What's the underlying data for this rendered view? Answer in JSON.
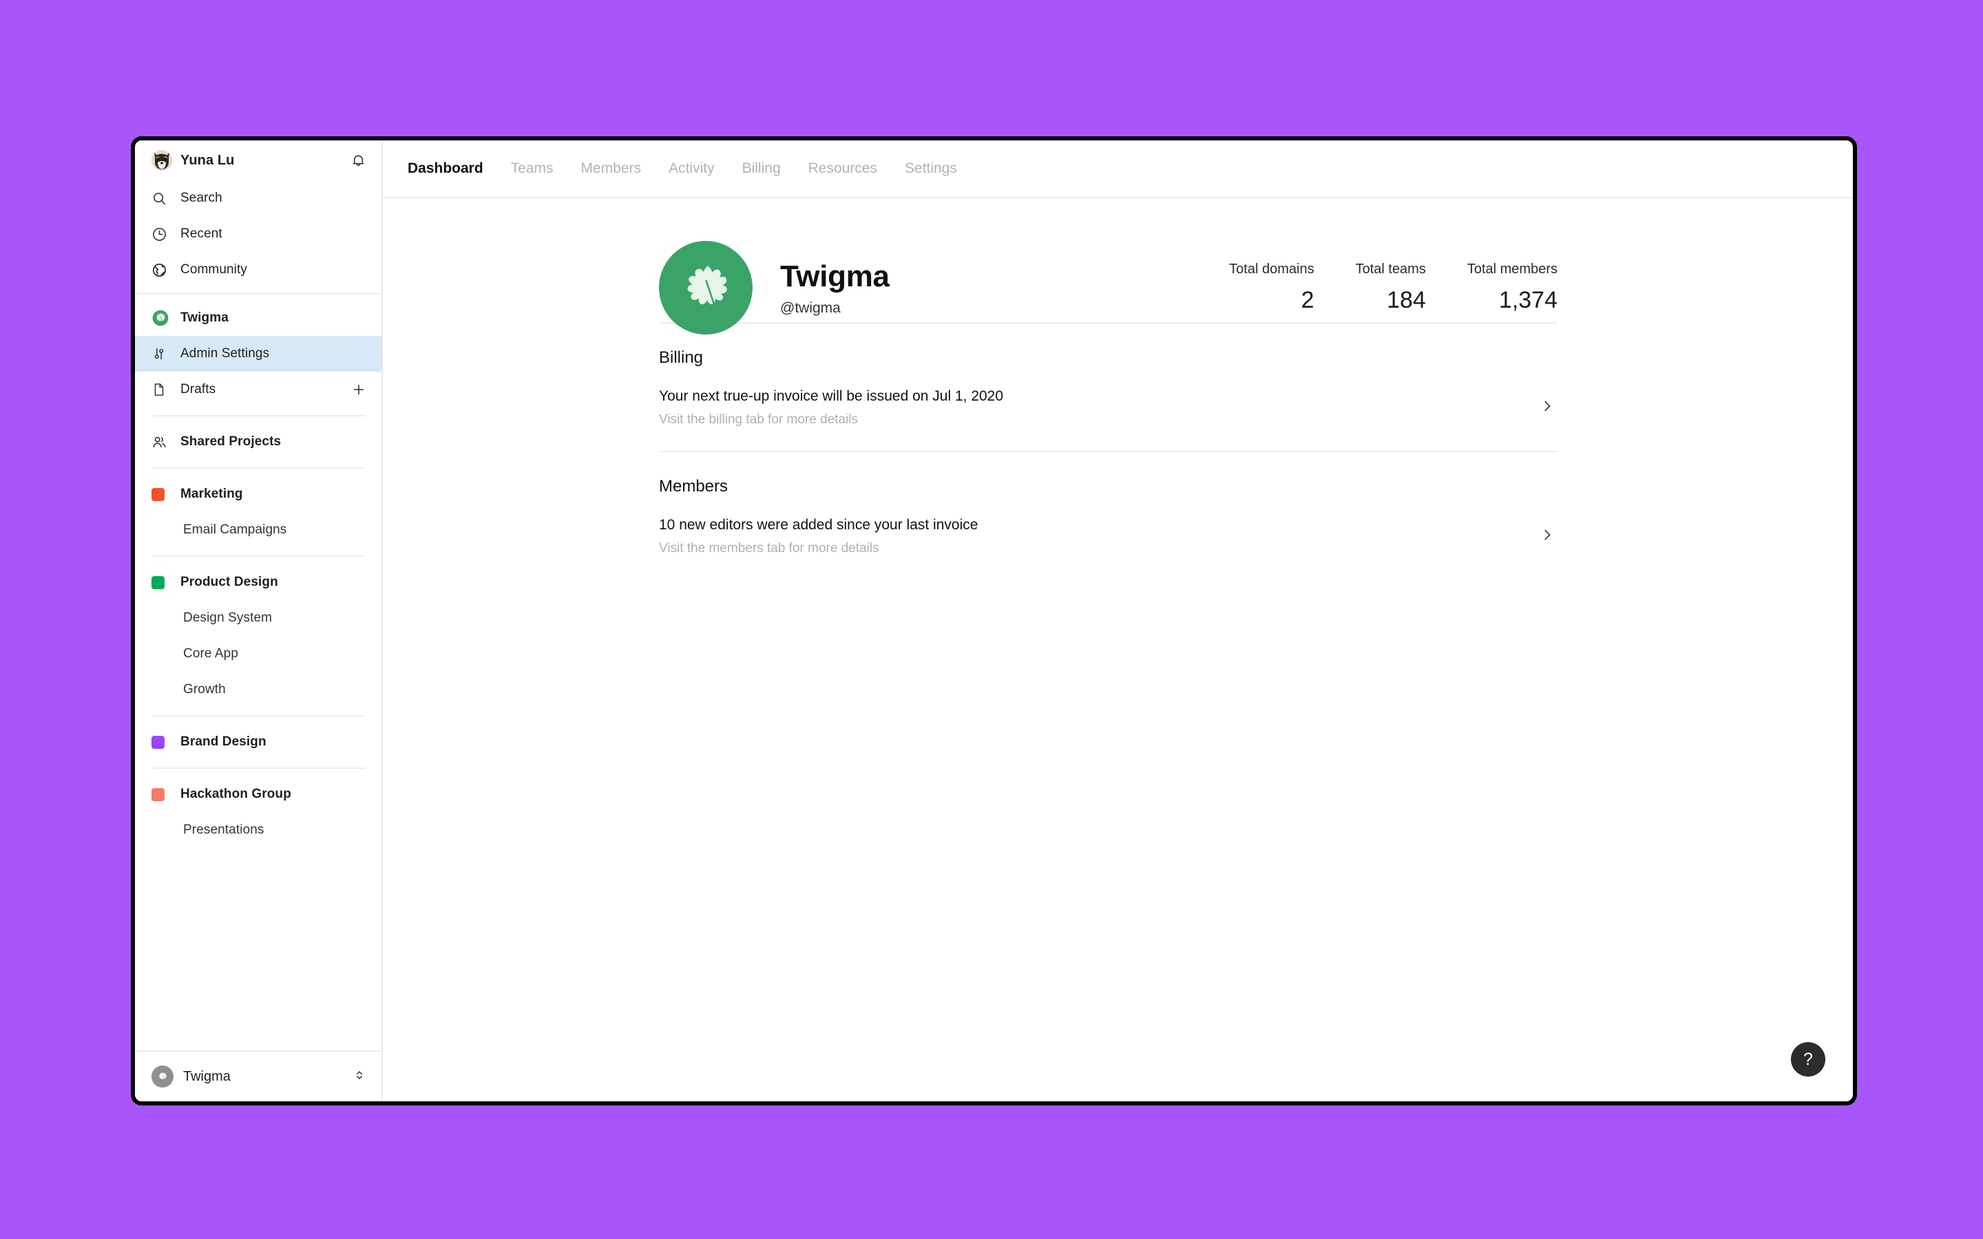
{
  "theme": {
    "page_background": "#a855fa",
    "window_border": "#000000",
    "active_nav_background": "#d7e8f6",
    "brand_green": "#3aa368",
    "divider": "#ececec"
  },
  "sidebar": {
    "user": {
      "name": "Yuna Lu",
      "avatar_icon": "shiba-dog-avatar",
      "bell_icon": "bell-icon"
    },
    "nav": [
      {
        "label": "Search",
        "icon": "search-icon"
      },
      {
        "label": "Recent",
        "icon": "clock-icon"
      },
      {
        "label": "Community",
        "icon": "globe-icon"
      }
    ],
    "org": {
      "label": "Twigma",
      "icon": "twigma-leaf-icon"
    },
    "org_items": [
      {
        "label": "Admin Settings",
        "icon": "sliders-icon",
        "active": true
      },
      {
        "label": "Drafts",
        "icon": "document-icon",
        "active": false,
        "trailing_icon": "plus-icon"
      }
    ],
    "shared": {
      "label": "Shared Projects",
      "icon": "people-icon"
    },
    "groups": [
      {
        "label": "Marketing",
        "color": "#f4502a",
        "children": [
          "Email Campaigns"
        ]
      },
      {
        "label": "Product Design",
        "color": "#00a95c",
        "children": [
          "Design System",
          "Core App",
          "Growth"
        ]
      },
      {
        "label": "Brand Design",
        "color": "#9747ff",
        "children": []
      },
      {
        "label": "Hackathon Group",
        "color": "#fa7a6a",
        "children": [
          "Presentations"
        ]
      }
    ],
    "footer": {
      "label": "Twigma",
      "icon": "twigma-leaf-icon",
      "trailing_icon": "chevron-updown-icon"
    }
  },
  "topbar": {
    "tabs": [
      {
        "label": "Dashboard",
        "active": true
      },
      {
        "label": "Teams",
        "active": false
      },
      {
        "label": "Members",
        "active": false
      },
      {
        "label": "Activity",
        "active": false
      },
      {
        "label": "Billing",
        "active": false
      },
      {
        "label": "Resources",
        "active": false
      },
      {
        "label": "Settings",
        "active": false
      }
    ]
  },
  "org_header": {
    "name": "Twigma",
    "handle": "@twigma",
    "avatar_icon": "twigma-leaf-icon",
    "stats": [
      {
        "key": "Total domains",
        "value": "2"
      },
      {
        "key": "Total teams",
        "value": "184"
      },
      {
        "key": "Total members",
        "value": "1,374"
      }
    ]
  },
  "sections": [
    {
      "heading": "Billing",
      "primary": "Your next true-up invoice will be issued on Jul 1, 2020",
      "secondary": "Visit the billing tab for more details",
      "chevron_icon": "chevron-right-icon"
    },
    {
      "heading": "Members",
      "primary": "10 new editors were added since your last invoice",
      "secondary": "Visit the members tab for more details",
      "chevron_icon": "chevron-right-icon"
    }
  ],
  "help_button": {
    "label": "?",
    "icon": "question-mark-icon"
  }
}
